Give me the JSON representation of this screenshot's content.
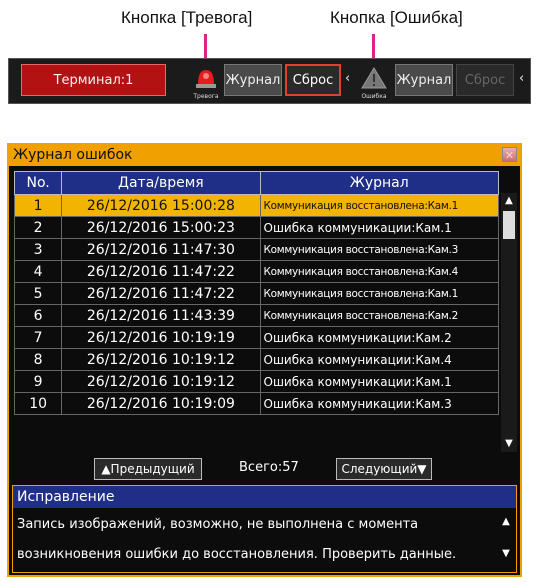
{
  "callouts": {
    "alarm": "Кнопка [Тревога]",
    "error": "Кнопка [Ошибка]"
  },
  "toolbar": {
    "terminal": "Терминал:1",
    "alarm_icon_label": "Тревога",
    "journal1": "Журнал",
    "reset1": "Сброс",
    "error_icon_label": "Ошибка",
    "journal2": "Журнал",
    "reset2": "Сброс",
    "arrow": "‹"
  },
  "dialog": {
    "title": "Журнал ошибок",
    "close": "✕",
    "headers": {
      "no": "No.",
      "datetime": "Дата/время",
      "log": "Журнал"
    },
    "rows": [
      {
        "no": "1",
        "dt": "26/12/2016   15:00:28",
        "log": "Коммуникация восстановлена:Кам.1"
      },
      {
        "no": "2",
        "dt": "26/12/2016   15:00:23",
        "log": "Ошибка коммуникации:Кам.1"
      },
      {
        "no": "3",
        "dt": "26/12/2016   11:47:30",
        "log": "Коммуникация восстановлена:Кам.3"
      },
      {
        "no": "4",
        "dt": "26/12/2016   11:47:22",
        "log": "Коммуникация восстановлена:Кам.4"
      },
      {
        "no": "5",
        "dt": "26/12/2016   11:47:22",
        "log": "Коммуникация восстановлена:Кам.1"
      },
      {
        "no": "6",
        "dt": "26/12/2016   11:43:39",
        "log": "Коммуникация восстановлена:Кам.2"
      },
      {
        "no": "7",
        "dt": "26/12/2016   10:19:19",
        "log": "Ошибка коммуникации:Кам.2"
      },
      {
        "no": "8",
        "dt": "26/12/2016   10:19:12",
        "log": "Ошибка коммуникации:Кам.4"
      },
      {
        "no": "9",
        "dt": "26/12/2016   10:19:12",
        "log": "Ошибка коммуникации:Кам.1"
      },
      {
        "no": "10",
        "dt": "26/12/2016   10:19:09",
        "log": "Ошибка коммуникации:Кам.3"
      }
    ],
    "prev": "▲Предыдущий",
    "total": "Всего:57",
    "next": "Следующий▼",
    "fix_title": "Исправление",
    "fix_line1": "Запись изображений, возможно, не выполнена с момента",
    "fix_line2": "возникновения ошибки до восстановления. Проверить данные.",
    "scroll_up": "▲",
    "scroll_down": "▼"
  },
  "colors": {
    "accent": "#f0a000",
    "header_blue": "#1f2f88",
    "terminal_red": "#b31212",
    "callout_line": "#e0218a"
  }
}
